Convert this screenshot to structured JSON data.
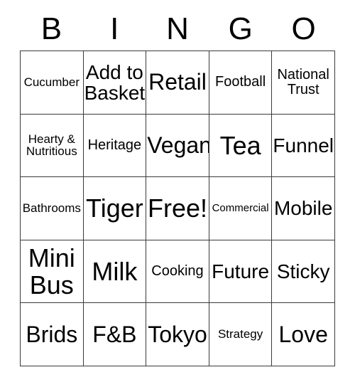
{
  "card": {
    "title": "BINGO",
    "header_letters": [
      "B",
      "I",
      "N",
      "G",
      "O"
    ],
    "columns": 5,
    "rows": 5,
    "border_color": "#3a3a3a",
    "text_color": "#000000",
    "background_color": "#ffffff",
    "free_space": "Free!",
    "free_space_position": "center",
    "cells": [
      [
        {
          "label": "Cucumber",
          "size": "sm"
        },
        {
          "label": "Add to\nBasket",
          "size": "xl"
        },
        {
          "label": "Retail",
          "size": "xxl"
        },
        {
          "label": "Football",
          "size": "md"
        },
        {
          "label": "National\nTrust",
          "size": "md"
        }
      ],
      [
        {
          "label": "Hearty &\nNutritious",
          "size": "sm"
        },
        {
          "label": "Heritage",
          "size": "md"
        },
        {
          "label": "Vegan",
          "size": "xxl"
        },
        {
          "label": "Tea",
          "size": "huge"
        },
        {
          "label": "Funnel",
          "size": "xl"
        }
      ],
      [
        {
          "label": "Bathrooms",
          "size": "sm"
        },
        {
          "label": "Tiger",
          "size": "huge"
        },
        {
          "label": "Free!",
          "size": "huge"
        },
        {
          "label": "Commercial",
          "size": "xs"
        },
        {
          "label": "Mobile",
          "size": "xl"
        }
      ],
      [
        {
          "label": "Mini\nBus",
          "size": "huge"
        },
        {
          "label": "Milk",
          "size": "huge"
        },
        {
          "label": "Cooking",
          "size": "md"
        },
        {
          "label": "Future",
          "size": "xl"
        },
        {
          "label": "Sticky",
          "size": "xl"
        }
      ],
      [
        {
          "label": "Brids",
          "size": "xxl"
        },
        {
          "label": "F&B",
          "size": "xxl"
        },
        {
          "label": "Tokyo",
          "size": "xxl"
        },
        {
          "label": "Strategy",
          "size": "sm"
        },
        {
          "label": "Love",
          "size": "xxl"
        }
      ]
    ]
  }
}
